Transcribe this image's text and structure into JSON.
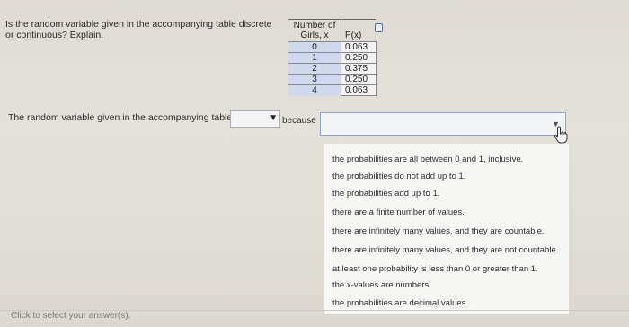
{
  "question": {
    "text_line1": "Is the random variable given in the accompanying table discrete",
    "text_line2": "or continuous? Explain."
  },
  "table": {
    "header_x_line1": "Number of",
    "header_x_line2": "Girls, x",
    "header_p": "P(x)",
    "rows": [
      {
        "x": "0",
        "p": "0.063"
      },
      {
        "x": "1",
        "p": "0.250"
      },
      {
        "x": "2",
        "p": "0.375"
      },
      {
        "x": "3",
        "p": "0.250"
      },
      {
        "x": "4",
        "p": "0.063"
      }
    ]
  },
  "answer": {
    "statement": "The random variable given in the accompanying table is",
    "select1_value": "",
    "because": "because",
    "select2_value": ""
  },
  "dropdown": {
    "options": [
      "the probabilities are all between 0 and 1, inclusive.",
      "the probabilities do not add up to 1.",
      "the probabilities add up to 1.",
      "there are a finite number of values.",
      "there are infinitely many values, and they are countable.",
      "there are infinitely many values, and they are not countable.",
      "at least one probability is less than 0 or greater than 1.",
      "the x-values are numbers.",
      "the probabilities are decimal values."
    ]
  },
  "footer": {
    "hint": "Click to select your answer(s)."
  },
  "icons": {
    "copy": "copy-icon",
    "cursor": "hand-pointer-icon",
    "dropdown_arrow": "triangle-down-icon"
  }
}
